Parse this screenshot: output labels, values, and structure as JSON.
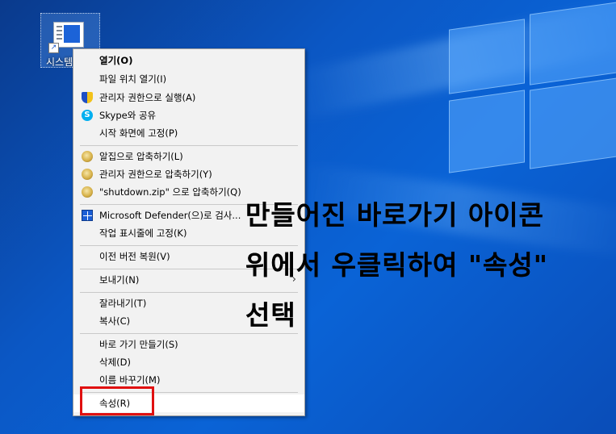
{
  "desktop": {
    "shortcut_label": "시스템"
  },
  "menu": {
    "items": [
      {
        "label": "열기(O)",
        "icon": "none"
      },
      {
        "label": "파일 위치 열기(I)",
        "icon": "none"
      },
      {
        "label": "관리자 권한으로 실행(A)",
        "icon": "uac-shield-icon"
      },
      {
        "label": "Skype와 공유",
        "icon": "skype-icon"
      },
      {
        "label": "시작 화면에 고정(P)",
        "icon": "none"
      },
      {
        "label": "알집으로 압축하기(L)",
        "icon": "alzip-icon"
      },
      {
        "label": "관리자 권한으로 압축하기(Y)",
        "icon": "alzip-admin-icon"
      },
      {
        "label": "\"shutdown.zip\" 으로 압축하기(Q)",
        "icon": "alzip-icon"
      },
      {
        "label": "Microsoft Defender(으)로 검사...",
        "icon": "defender-icon"
      },
      {
        "label": "작업 표시줄에 고정(K)",
        "icon": "none"
      },
      {
        "label": "이전 버전 복원(V)",
        "icon": "none"
      },
      {
        "label": "보내기(N)",
        "icon": "chevron-right-icon"
      },
      {
        "label": "잘라내기(T)",
        "icon": "none"
      },
      {
        "label": "복사(C)",
        "icon": "none"
      },
      {
        "label": "바로 가기 만들기(S)",
        "icon": "none"
      },
      {
        "label": "삭제(D)",
        "icon": "none"
      },
      {
        "label": "이름 바꾸기(M)",
        "icon": "none"
      },
      {
        "label": "속성(R)",
        "icon": "none"
      }
    ],
    "highlight_color": "#e01010"
  },
  "caption": {
    "line1": "만들어진 바로가기 아이콘",
    "line2": "위에서 우클릭하여 \"속성\"",
    "line3": "선택"
  }
}
